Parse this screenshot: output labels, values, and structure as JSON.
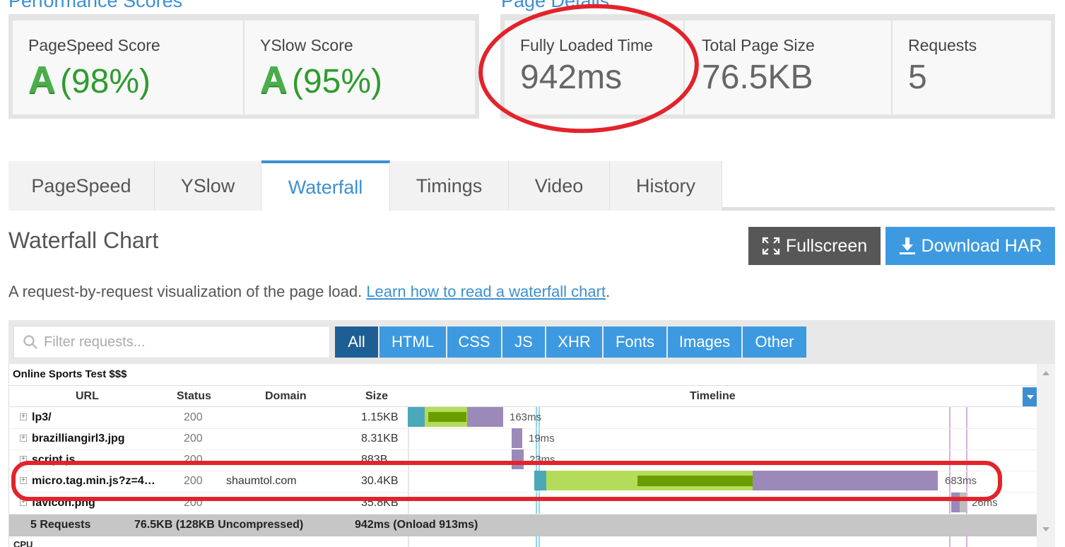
{
  "performance": {
    "title": "Performance Scores",
    "pagespeed_label": "PageSpeed Score",
    "pagespeed_grade": "A",
    "pagespeed_pct": "(98%)",
    "yslow_label": "YSlow Score",
    "yslow_grade": "A",
    "yslow_pct": "(95%)"
  },
  "details": {
    "title": "Page Details",
    "loaded_label": "Fully Loaded Time",
    "loaded_value": "942ms",
    "size_label": "Total Page Size",
    "size_value": "76.5KB",
    "requests_label": "Requests",
    "requests_value": "5"
  },
  "tabs": [
    "PageSpeed",
    "YSlow",
    "Waterfall",
    "Timings",
    "Video",
    "History"
  ],
  "active_tab": "Waterfall",
  "waterfall": {
    "title": "Waterfall Chart",
    "fullscreen_label": "Fullscreen",
    "download_label": "Download HAR",
    "desc_text": "A request-by-request visualization of the page load. ",
    "desc_link": "Learn how to read a waterfall chart",
    "desc_end": "."
  },
  "filter": {
    "placeholder": "Filter requests...",
    "types": [
      "All",
      "HTML",
      "CSS",
      "JS",
      "XHR",
      "Fonts",
      "Images",
      "Other"
    ]
  },
  "table": {
    "test_name": "Online Sports Test $$$",
    "headers": {
      "url": "URL",
      "status": "Status",
      "domain": "Domain",
      "size": "Size",
      "timeline": "Timeline"
    },
    "rows": [
      {
        "url": "lp3/",
        "status": "200",
        "domain": "",
        "size": "1.15KB",
        "timing": "163ms"
      },
      {
        "url": "brazilliangirl3.jpg",
        "status": "200",
        "domain": "",
        "size": "8.31KB",
        "timing": "19ms"
      },
      {
        "url": "script.js",
        "status": "200",
        "domain": "",
        "size": "883B",
        "timing": "23ms"
      },
      {
        "url": "micro.tag.min.js?z=4…",
        "status": "200",
        "domain": "shaumtol.com",
        "size": "30.4KB",
        "timing": "683ms"
      },
      {
        "url": "favicon.png",
        "status": "200",
        "domain": "",
        "size": "35.8KB",
        "timing": "26ms"
      }
    ],
    "summary": {
      "requests": "5 Requests",
      "size": "76.5KB  (128KB Uncompressed)",
      "time": "942ms  (Onload 913ms)"
    },
    "cpu_label": "CPU"
  },
  "colors": {
    "accent": "#3d8fd1",
    "grade_green": "#2e9c2e",
    "annotation_red": "#e3232b",
    "bar_teal": "#4aa8b9",
    "bar_lightgreen": "#b4dc5a",
    "bar_green": "#6a9e00",
    "bar_purple": "#9b8ab9"
  }
}
